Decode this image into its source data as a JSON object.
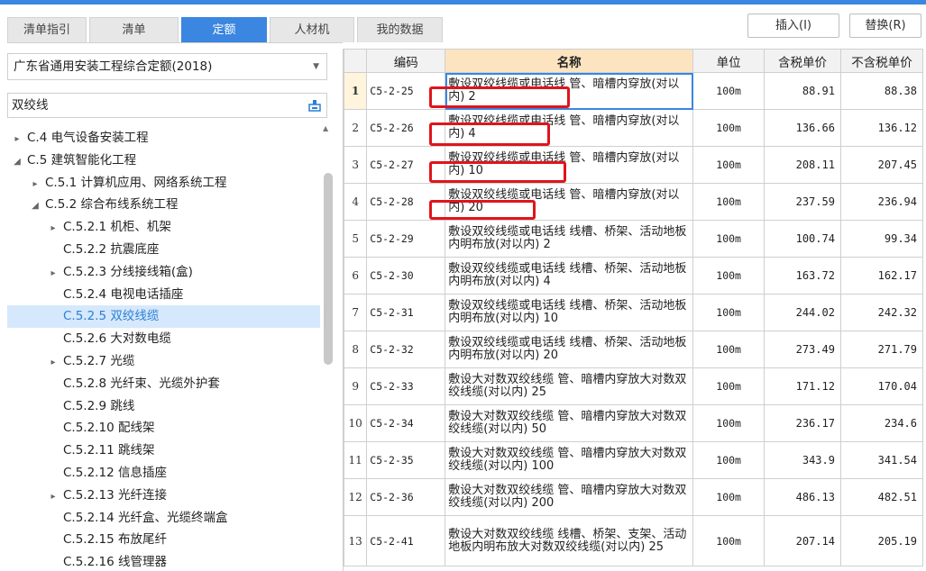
{
  "tabs": [
    {
      "label": "清单指引",
      "active": false
    },
    {
      "label": "清单",
      "active": false
    },
    {
      "label": "定额",
      "active": true
    },
    {
      "label": "人材机",
      "active": false
    },
    {
      "label": "我的数据",
      "active": false
    }
  ],
  "buttons": {
    "insert": "插入(I)",
    "replace": "替换(R)"
  },
  "left": {
    "quota_select": "广东省通用安装工程综合定额(2018)",
    "search_value": "双绞线"
  },
  "tree": [
    {
      "label": "C.4 电气设备安装工程",
      "arrow": "▸",
      "level": 0
    },
    {
      "label": "C.5 建筑智能化工程",
      "arrow": "◢",
      "level": 0
    },
    {
      "label": "C.5.1 计算机应用、网络系统工程",
      "arrow": "▸",
      "level": 1
    },
    {
      "label": "C.5.2 综合布线系统工程",
      "arrow": "◢",
      "level": 1
    },
    {
      "label": "C.5.2.1 机柜、机架",
      "arrow": "▸",
      "level": 2
    },
    {
      "label": "C.5.2.2 抗震底座",
      "arrow": "",
      "level": 2
    },
    {
      "label": "C.5.2.3 分线接线箱(盒)",
      "arrow": "▸",
      "level": 2
    },
    {
      "label": "C.5.2.4 电视电话插座",
      "arrow": "",
      "level": 2
    },
    {
      "label": "C.5.2.5 双绞线缆",
      "arrow": "",
      "level": 2,
      "selected": true
    },
    {
      "label": "C.5.2.6 大对数电缆",
      "arrow": "",
      "level": 2
    },
    {
      "label": "C.5.2.7 光缆",
      "arrow": "▸",
      "level": 2
    },
    {
      "label": "C.5.2.8 光纤束、光缆外护套",
      "arrow": "",
      "level": 2
    },
    {
      "label": "C.5.2.9 跳线",
      "arrow": "",
      "level": 2
    },
    {
      "label": "C.5.2.10 配线架",
      "arrow": "",
      "level": 2
    },
    {
      "label": "C.5.2.11 跳线架",
      "arrow": "",
      "level": 2
    },
    {
      "label": "C.5.2.12 信息插座",
      "arrow": "",
      "level": 2
    },
    {
      "label": "C.5.2.13 光纤连接",
      "arrow": "▸",
      "level": 2
    },
    {
      "label": "C.5.2.14 光纤盒、光缆终端盒",
      "arrow": "",
      "level": 2
    },
    {
      "label": "C.5.2.15 布放尾纤",
      "arrow": "",
      "level": 2
    },
    {
      "label": "C.5.2.16 线管理器",
      "arrow": "",
      "level": 2
    }
  ],
  "table": {
    "headers": [
      "",
      "编码",
      "名称",
      "单位",
      "含税单价",
      "不含税单价"
    ],
    "rows": [
      {
        "n": "1",
        "code": "C5-2-25",
        "name": "敷设双绞线缆或电话线 管、暗槽内穿放(对以内) 2",
        "unit": "100m",
        "tax": "88.91",
        "notax": "88.38"
      },
      {
        "n": "2",
        "code": "C5-2-26",
        "name": "敷设双绞线缆或电话线 管、暗槽内穿放(对以内) 4",
        "unit": "100m",
        "tax": "136.66",
        "notax": "136.12"
      },
      {
        "n": "3",
        "code": "C5-2-27",
        "name": "敷设双绞线缆或电话线 管、暗槽内穿放(对以内) 10",
        "unit": "100m",
        "tax": "208.11",
        "notax": "207.45"
      },
      {
        "n": "4",
        "code": "C5-2-28",
        "name": "敷设双绞线缆或电话线 管、暗槽内穿放(对以内) 20",
        "unit": "100m",
        "tax": "237.59",
        "notax": "236.94"
      },
      {
        "n": "5",
        "code": "C5-2-29",
        "name": "敷设双绞线缆或电话线 线槽、桥架、活动地板内明布放(对以内) 2",
        "unit": "100m",
        "tax": "100.74",
        "notax": "99.34"
      },
      {
        "n": "6",
        "code": "C5-2-30",
        "name": "敷设双绞线缆或电话线 线槽、桥架、活动地板内明布放(对以内) 4",
        "unit": "100m",
        "tax": "163.72",
        "notax": "162.17"
      },
      {
        "n": "7",
        "code": "C5-2-31",
        "name": "敷设双绞线缆或电话线 线槽、桥架、活动地板内明布放(对以内) 10",
        "unit": "100m",
        "tax": "244.02",
        "notax": "242.32"
      },
      {
        "n": "8",
        "code": "C5-2-32",
        "name": "敷设双绞线缆或电话线 线槽、桥架、活动地板内明布放(对以内) 20",
        "unit": "100m",
        "tax": "273.49",
        "notax": "271.79"
      },
      {
        "n": "9",
        "code": "C5-2-33",
        "name": "敷设大对数双绞线缆 管、暗槽内穿放大对数双绞线缆(对以内) 25",
        "unit": "100m",
        "tax": "171.12",
        "notax": "170.04"
      },
      {
        "n": "10",
        "code": "C5-2-34",
        "name": "敷设大对数双绞线缆 管、暗槽内穿放大对数双绞线缆(对以内) 50",
        "unit": "100m",
        "tax": "236.17",
        "notax": "234.6"
      },
      {
        "n": "11",
        "code": "C5-2-35",
        "name": "敷设大对数双绞线缆 管、暗槽内穿放大对数双绞线缆(对以内) 100",
        "unit": "100m",
        "tax": "343.9",
        "notax": "341.54"
      },
      {
        "n": "12",
        "code": "C5-2-36",
        "name": "敷设大对数双绞线缆 管、暗槽内穿放大对数双绞线缆(对以内) 200",
        "unit": "100m",
        "tax": "486.13",
        "notax": "482.51"
      },
      {
        "n": "13",
        "code": "C5-2-41",
        "name": "敷设大对数双绞线缆 线槽、桥架、支架、活动地板内明布放大对数双绞线缆(对以内) 25",
        "unit": "100m",
        "tax": "207.14",
        "notax": "205.19"
      }
    ]
  },
  "colors": {
    "accent": "#3a86e0",
    "highlight": "#e0141c",
    "name_header": "#fce4c0"
  }
}
